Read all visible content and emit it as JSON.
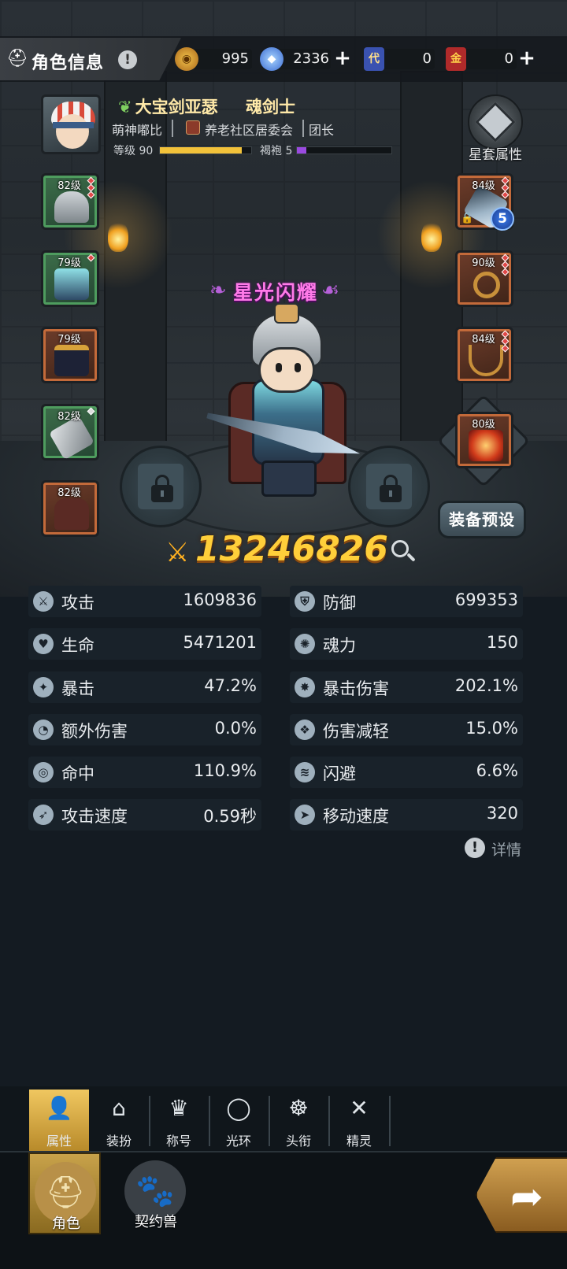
{
  "header": {
    "title": "角色信息",
    "currencies": [
      {
        "name": "gold-coin",
        "value": "995",
        "has_plus": false
      },
      {
        "name": "crystal",
        "value": "2336",
        "has_plus": true
      },
      {
        "name": "voucher-card",
        "value": "0",
        "has_plus": false
      },
      {
        "name": "gold-card",
        "value": "0",
        "has_plus": true
      }
    ]
  },
  "player": {
    "name": "大宝剑亚瑟",
    "class": "魂剑士",
    "tag": "萌神嘟比",
    "guild": "养老社区居委会",
    "role": "团长",
    "level_label": "等级 90",
    "level_progress": 0.9,
    "robe_label": "褐袍 5",
    "robe_progress": 0.1
  },
  "star_set": {
    "label": "星套属性"
  },
  "equipment_left": [
    {
      "level": "82级",
      "rarity": "green",
      "item": "helmet"
    },
    {
      "level": "79级",
      "rarity": "green",
      "item": "armor"
    },
    {
      "level": "79级",
      "rarity": "orange",
      "item": "boots"
    },
    {
      "level": "82级",
      "rarity": "green",
      "item": "gauntlet"
    },
    {
      "level": "82级",
      "rarity": "orange",
      "item": "cape"
    }
  ],
  "equipment_right": [
    {
      "level": "84级",
      "rarity": "orange",
      "item": "greatsword",
      "star": "5"
    },
    {
      "level": "90级",
      "rarity": "orange",
      "item": "ring"
    },
    {
      "level": "84级",
      "rarity": "orange",
      "item": "necklace"
    },
    {
      "level": "80级",
      "rarity": "orange",
      "item": "relic"
    }
  ],
  "hero_title": "星光闪耀",
  "preset_button": "装备预设",
  "combat_power": "13246826",
  "stats": [
    {
      "label": "攻击",
      "value": "1609836",
      "icon": "sword"
    },
    {
      "label": "防御",
      "value": "699353",
      "icon": "shield"
    },
    {
      "label": "生命",
      "value": "5471201",
      "icon": "heart"
    },
    {
      "label": "魂力",
      "value": "150",
      "icon": "soul"
    },
    {
      "label": "暴击",
      "value": "47.2%",
      "icon": "crit"
    },
    {
      "label": "暴击伤害",
      "value": "202.1%",
      "icon": "burst"
    },
    {
      "label": "额外伤害",
      "value": "0.0%",
      "icon": "extra"
    },
    {
      "label": "伤害减轻",
      "value": "15.0%",
      "icon": "reduce"
    },
    {
      "label": "命中",
      "value": "110.9%",
      "icon": "target"
    },
    {
      "label": "闪避",
      "value": "6.6%",
      "icon": "dodge"
    },
    {
      "label": "攻击速度",
      "value": "0.59秒",
      "icon": "atk-speed"
    },
    {
      "label": "移动速度",
      "value": "320",
      "icon": "move-speed"
    }
  ],
  "detail_link": "详情",
  "sub_tabs": [
    {
      "label": "属性",
      "icon": "person",
      "active": true
    },
    {
      "label": "装扮",
      "icon": "hanger",
      "active": false
    },
    {
      "label": "称号",
      "icon": "crown",
      "active": false
    },
    {
      "label": "光环",
      "icon": "halo",
      "active": false
    },
    {
      "label": "头衔",
      "icon": "emblem",
      "active": false
    },
    {
      "label": "精灵",
      "icon": "spirit",
      "active": false
    }
  ],
  "main_nav": [
    {
      "label": "角色",
      "icon": "helmet",
      "active": true
    },
    {
      "label": "契约兽",
      "icon": "paw",
      "active": false
    }
  ],
  "colors": {
    "accent_gold": "#ffcf3a",
    "title_pink": "#ff7ae8",
    "rarity_green": "#4e9c5e",
    "rarity_orange": "#c36a3a",
    "level_bar": "#f2c23a",
    "robe_bar": "#9a4ae0"
  }
}
